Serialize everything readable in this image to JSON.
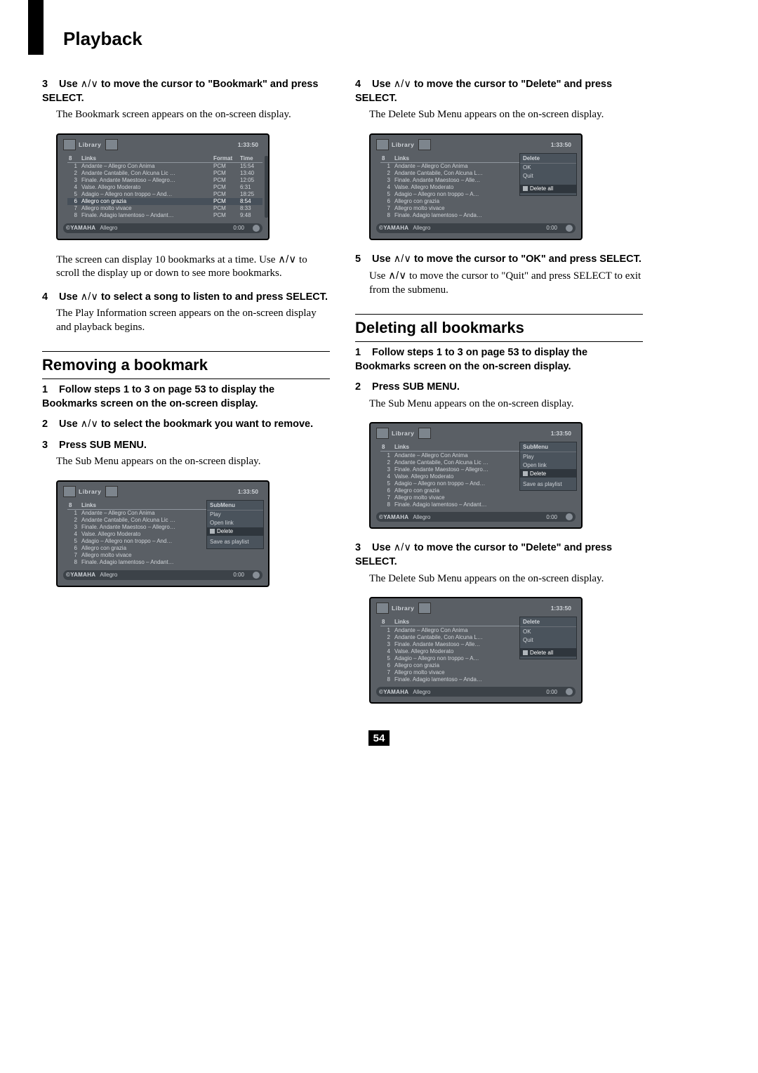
{
  "page_title": "Playback",
  "page_number": "54",
  "left": {
    "step3": {
      "num": "3",
      "bold_a": "Use ",
      "arrows": "∧/∨",
      "bold_b": " to move the cursor to \"Bookmark\" and press SELECT.",
      "body": "The Bookmark screen appears on the on-screen display."
    },
    "fig1_note1": "The screen can display 10 bookmarks at a time. Use ",
    "fig1_note_arrows": "∧/∨",
    "fig1_note2": " to scroll the display up or down to see more bookmarks.",
    "step4": {
      "num": "4",
      "bold_a": "Use ",
      "arrows": "∧/∨",
      "bold_b": " to select a song to listen to and press SELECT.",
      "body": "The Play Information screen appears on the on-screen display and playback begins."
    },
    "section": "Removing a bookmark",
    "r1": {
      "num": "1",
      "bold": "Follow steps 1 to 3 on page 53 to display the Bookmarks screen on the on-screen display."
    },
    "r2": {
      "num": "2",
      "bold_a": "Use ",
      "arrows": "∧/∨",
      "bold_b": " to select the bookmark you want to remove."
    },
    "r3": {
      "num": "3",
      "bold": "Press SUB MENU.",
      "body": "The Sub Menu appears on the on-screen display."
    }
  },
  "right": {
    "step4": {
      "num": "4",
      "bold_a": "Use ",
      "arrows": "∧/∨",
      "bold_b": " to move the cursor to \"Delete\" and press SELECT.",
      "body": "The Delete Sub Menu appears on the on-screen display."
    },
    "step5": {
      "num": "5",
      "bold_a": "Use ",
      "arrows": "∧/∨",
      "bold_b": " to move the cursor to \"OK\" and press SELECT.",
      "body_a": "Use ",
      "body_arrows": "∧/∨",
      "body_b": " to move the cursor to \"Quit\" and press SELECT to exit from the submenu."
    },
    "section": "Deleting all bookmarks",
    "d1": {
      "num": "1",
      "bold": "Follow steps 1 to 3 on page 53 to display the Bookmarks screen on the on-screen display."
    },
    "d2": {
      "num": "2",
      "bold": "Press SUB MENU.",
      "body": "The Sub Menu appears on the on-screen display."
    },
    "d3": {
      "num": "3",
      "bold_a": "Use ",
      "arrows": "∧/∨",
      "bold_b": " to move the cursor to \"Delete\" and press SELECT.",
      "body": "The Delete Sub Menu appears on the on-screen display."
    }
  },
  "screen_common": {
    "library": "Library",
    "top_time": "1:33:50",
    "links_count": "8",
    "links_label": "Links",
    "brand": "©YAMAHA",
    "status_track": "Allegro",
    "status_time": "0:00"
  },
  "screen_bookmark": {
    "col_format": "Format",
    "col_time": "Time",
    "rows": [
      {
        "n": "1",
        "t": "Andante – Allegro Con Anima",
        "f": "PCM",
        "d": "15:54"
      },
      {
        "n": "2",
        "t": "Andante Cantabile, Con Alcuna Lic …",
        "f": "PCM",
        "d": "13:40"
      },
      {
        "n": "3",
        "t": "Finale. Andante Maestoso – Allegro…",
        "f": "PCM",
        "d": "12:05"
      },
      {
        "n": "4",
        "t": "Valse. Allegro Moderato",
        "f": "PCM",
        "d": "6:31"
      },
      {
        "n": "5",
        "t": "Adagio – Allegro non troppo – And…",
        "f": "PCM",
        "d": "18:25"
      },
      {
        "n": "6",
        "t": "Allegro con grazia",
        "f": "PCM",
        "d": "8:54"
      },
      {
        "n": "7",
        "t": "Allegro molto vivace",
        "f": "PCM",
        "d": "8:33"
      },
      {
        "n": "8",
        "t": "Finale. Adagio lamentoso – Andant…",
        "f": "PCM",
        "d": "9:48"
      }
    ],
    "highlight_index": 5
  },
  "screen_submenu": {
    "title": "SubMenu",
    "items": [
      "Play",
      "Open link",
      "Delete",
      "",
      "Save as playlist"
    ],
    "highlight_index": 2,
    "rows": [
      {
        "n": "1",
        "t": "Andante – Allegro Con Anima"
      },
      {
        "n": "2",
        "t": "Andante Cantabile, Con Alcuna Lic …"
      },
      {
        "n": "3",
        "t": "Finale. Andante Maestoso – Allegro…"
      },
      {
        "n": "4",
        "t": "Valse. Allegro Moderato"
      },
      {
        "n": "5",
        "t": "Adagio – Allegro non troppo – And…"
      },
      {
        "n": "6",
        "t": "Allegro con grazia"
      },
      {
        "n": "7",
        "t": "Allegro molto vivace"
      },
      {
        "n": "8",
        "t": "Finale. Adagio lamentoso – Andant…"
      }
    ]
  },
  "screen_delete": {
    "title": "Delete",
    "items": [
      "OK",
      "Quit",
      "",
      "",
      "Delete all"
    ],
    "highlight_index": 4,
    "rows": [
      {
        "n": "1",
        "t": "Andante – Allegro Con Anima"
      },
      {
        "n": "2",
        "t": "Andante Cantabile, Con Alcuna L…"
      },
      {
        "n": "3",
        "t": "Finale. Andante Maestoso – Alle…"
      },
      {
        "n": "4",
        "t": "Valse. Allegro Moderato"
      },
      {
        "n": "5",
        "t": "Adagio – Allegro non troppo – A…"
      },
      {
        "n": "6",
        "t": "Allegro con grazia"
      },
      {
        "n": "7",
        "t": "Allegro molto vivace"
      },
      {
        "n": "8",
        "t": "Finale. Adagio lamentoso – Anda…"
      }
    ]
  }
}
